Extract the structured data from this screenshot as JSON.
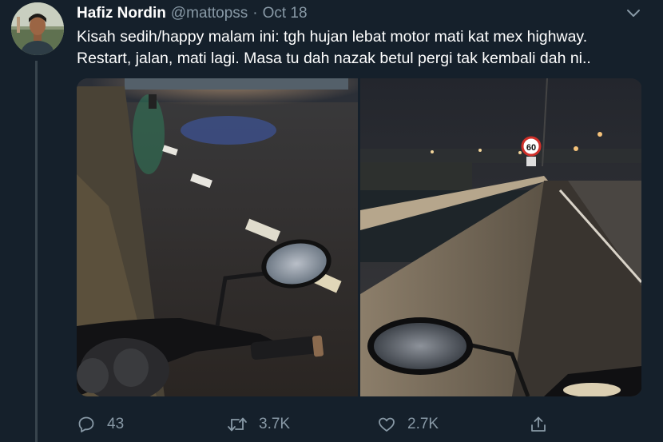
{
  "author": {
    "name": "Hafiz Nordin",
    "handle": "@mattopss",
    "separator": "·",
    "date": "Oct 18"
  },
  "tweet": {
    "text_lines": [
      "Kisah sedih/happy malam ini: tgh hujan lebat motor mati kat mex highway.",
      "Restart, jalan, mati lagi. Masa tu dah nazak betul pergi tak kembali dah ni.."
    ]
  },
  "media": {
    "photos": [
      {
        "subject": "wet-road-with-motorcycle-mirror"
      },
      {
        "subject": "highway-barrier-with-motorcycle-mirror",
        "sign_text": "60"
      }
    ]
  },
  "actions": {
    "reply_count": "43",
    "retweet_count": "3.7K",
    "like_count": "2.7K"
  },
  "icons": {
    "reply": "reply-icon",
    "retweet": "retweet-icon",
    "like": "heart-icon",
    "share": "share-icon",
    "menu": "chevron-down-icon"
  },
  "colors": {
    "background": "#15202b",
    "secondary_text": "#8899a6",
    "thread_line": "#38444d"
  }
}
